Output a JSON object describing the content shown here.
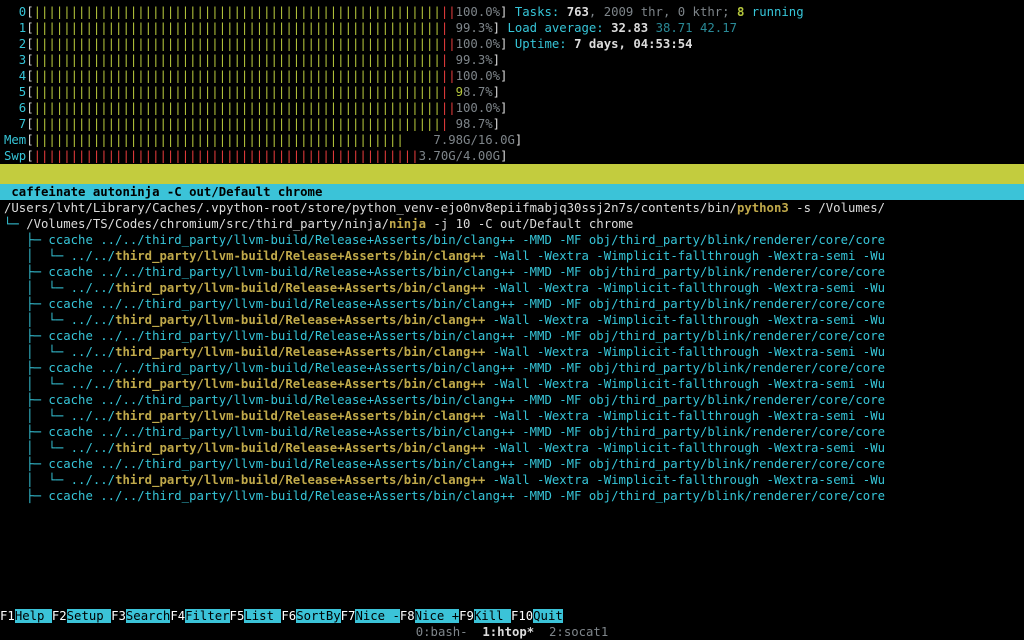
{
  "cpu_bars": [
    {
      "idx": "0",
      "fill": 55,
      "red": 2,
      "pct": "100.0%"
    },
    {
      "idx": "1",
      "fill": 55,
      "red": 1,
      "pct": "99.3%",
      "pad": " "
    },
    {
      "idx": "2",
      "fill": 55,
      "red": 2,
      "pct": "100.0%"
    },
    {
      "idx": "3",
      "fill": 55,
      "red": 1,
      "pct": "99.3%",
      "pad": " "
    },
    {
      "idx": "4",
      "fill": 55,
      "red": 2,
      "pct": "100.0%"
    },
    {
      "idx": "5",
      "fill": 55,
      "red": 1,
      "pct": "98.7%",
      "pad": " ",
      "green_pct": true
    },
    {
      "idx": "6",
      "fill": 55,
      "red": 2,
      "pct": "100.0%"
    },
    {
      "idx": "7",
      "fill": 55,
      "red": 1,
      "pct": "98.7%",
      "pad": " "
    }
  ],
  "mem": {
    "label": "Mem",
    "fill": 50,
    "red": 0,
    "used": "7.98G",
    "total": "/16.0G"
  },
  "swp": {
    "label": "Swp",
    "fill": 52,
    "red": 52,
    "used": "3.70G",
    "total": "/4.00G"
  },
  "tasks": {
    "label": "Tasks: ",
    "total": "763",
    "thr": ", 2009 thr, 0 kthr; ",
    "running": "8",
    "running_label": " running"
  },
  "load": {
    "label": "Load average: ",
    "l1": "32.83",
    "l5": "38.71",
    "l15": "42.17"
  },
  "uptime": {
    "label": "Uptime: ",
    "value": "7 days, 04:53:54"
  },
  "command_header": " caffeinate autoninja -C out/Default chrome",
  "proc_root_pre": "/Users/lvht/Library/Caches/.vpython-root/store/python_venv-ejo0nv8epiifmabjq30ssj2n7s/contents/bin/",
  "proc_root_py": "python3",
  "proc_root_post": " -s /Volumes/",
  "ninja_pre": "/Volumes/TS/Codes/chromium/src/third_party/ninja/",
  "ninja": "ninja",
  "ninja_post": " -j 10 -C out/Default chrome",
  "cc_line1": "ccache ../../third_party/llvm-build/Release+Asserts/bin/clang++ -MMD -MF obj/third_party/blink/renderer/core/core",
  "cc_sub_pre": "../../",
  "cc_sub_hl": "third_party/llvm-build/Release+Asserts/bin/clang++",
  "cc_sub_post": " -Wall -Wextra -Wimplicit-fallthrough -Wextra-semi -Wu",
  "last_line": "ccache ../../third_party/llvm-build/Release+Asserts/bin/clang++ -MMD -MF obj/third_party/blink/renderer/core/core",
  "fkeys": [
    {
      "k": "F1",
      "l": "Help  "
    },
    {
      "k": "F2",
      "l": "Setup "
    },
    {
      "k": "F3",
      "l": "Search"
    },
    {
      "k": "F4",
      "l": "Filter"
    },
    {
      "k": "F5",
      "l": "List  "
    },
    {
      "k": "F6",
      "l": "SortBy"
    },
    {
      "k": "F7",
      "l": "Nice -"
    },
    {
      "k": "F8",
      "l": "Nice +"
    },
    {
      "k": "F9",
      "l": "Kill  "
    },
    {
      "k": "F10",
      "l": "Quit"
    }
  ],
  "tabs": "0:bash-  1:htop*  2:socat1"
}
